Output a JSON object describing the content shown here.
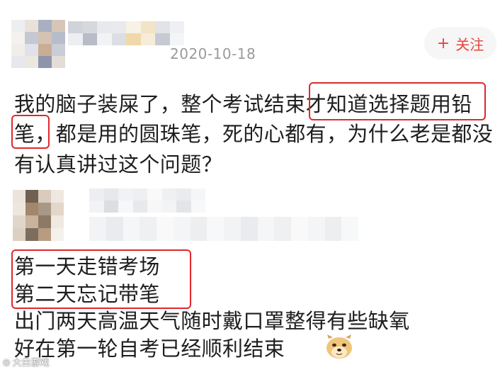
{
  "post": {
    "date": "2020-10-18",
    "follow_button": {
      "icon": "plus-icon",
      "label": "关注"
    },
    "text_lines": [
      "我的脑子装屎了，整个考试结束才知道选择题用铅",
      "笔，都是用的圆珠笔，死的心都有，为什么老是都没",
      "有认真讲过这个问题？"
    ]
  },
  "reply": {
    "text_lines": [
      "第一天走错考场",
      "第二天忘记带笔",
      "出门两天高温天气随时戴口罩整得有些缺氧",
      "好在第一轮自考已经顺利结束"
    ],
    "emoji": "doge-emoji-icon"
  },
  "watermark": {
    "icon": "logo-icon",
    "text": "大白游戏"
  },
  "colors": {
    "highlight_box": "#e0282c",
    "follow_text": "#e8453c",
    "follow_bg": "#f6f6f6",
    "date": "#9a9a9a"
  }
}
